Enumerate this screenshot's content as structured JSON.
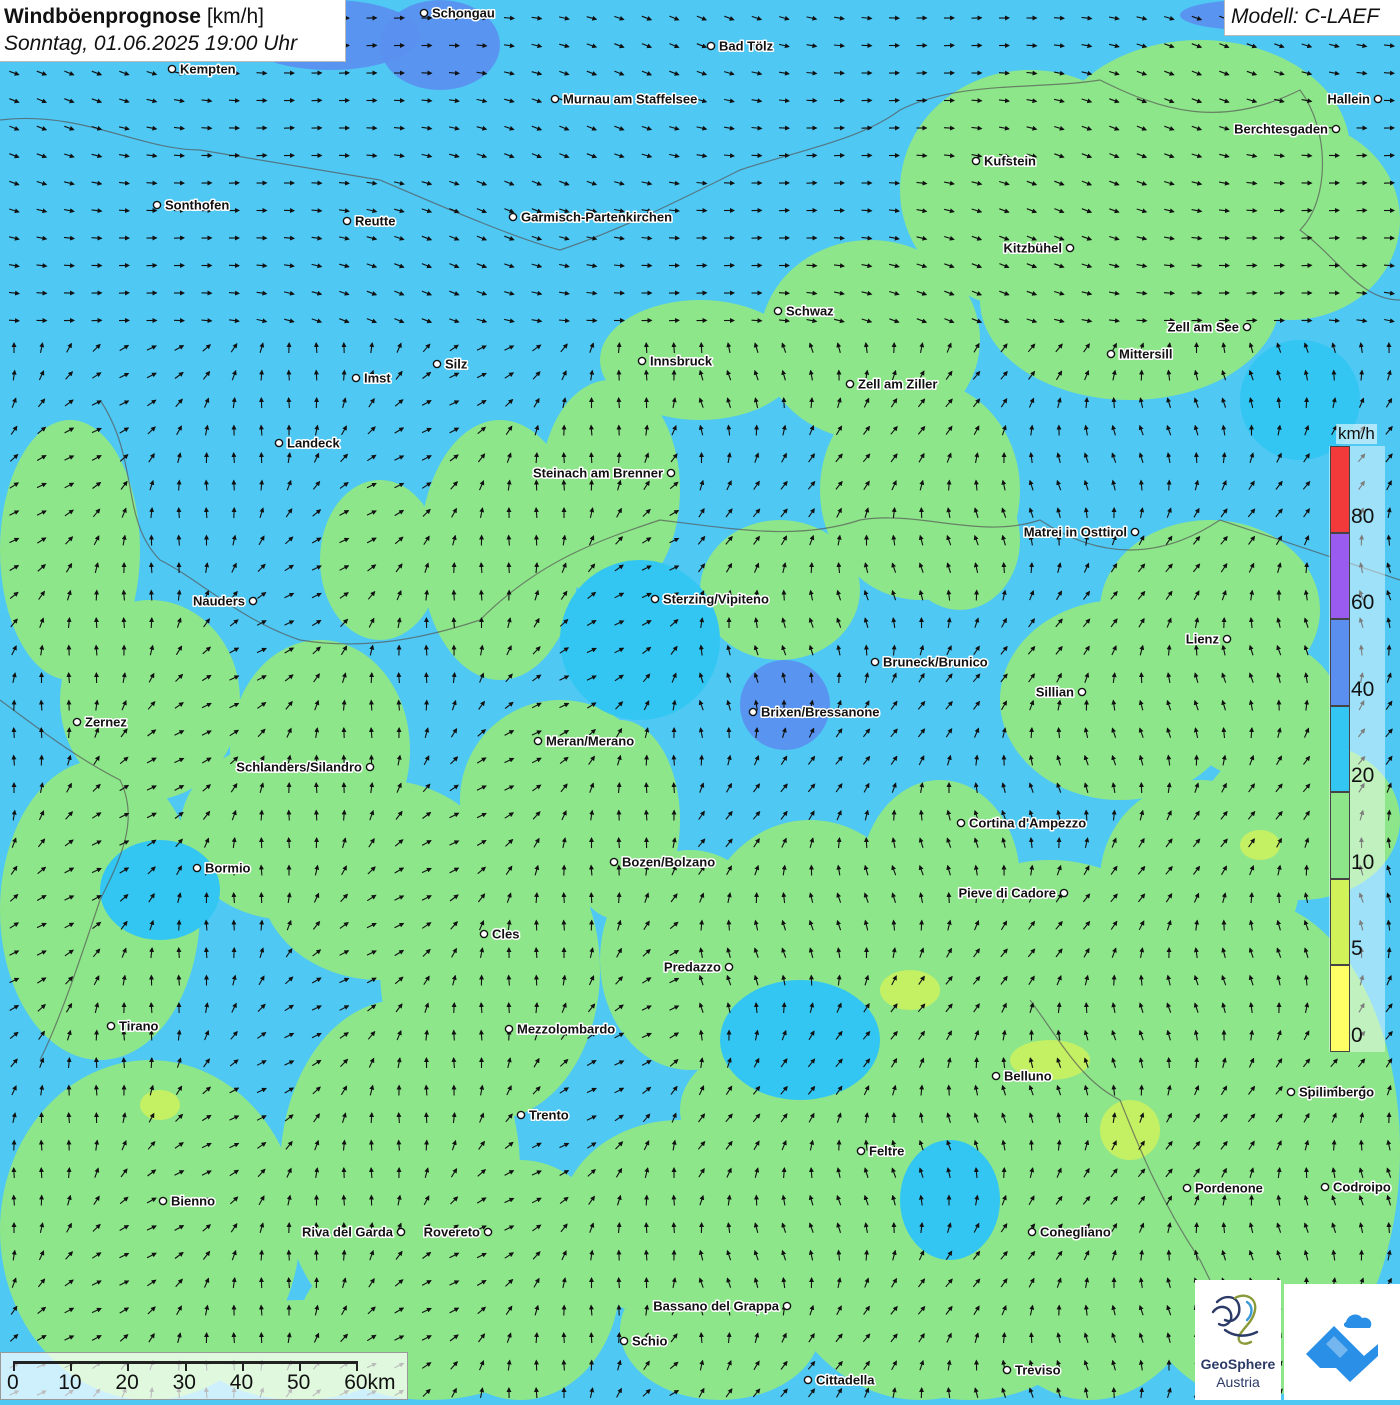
{
  "header": {
    "title": "Windböenprognose",
    "unit": "[km/h]",
    "datetime": "Sonntag, 01.06.2025 19:00 Uhr",
    "model": "Modell: C-LAEF"
  },
  "legend": {
    "unit": "km/h",
    "bins": [
      {
        "from": 0,
        "to": 5,
        "color": "#ffff66"
      },
      {
        "from": 5,
        "to": 10,
        "color": "#d2f25a"
      },
      {
        "from": 10,
        "to": 20,
        "color": "#8ee68a"
      },
      {
        "from": 20,
        "to": 40,
        "color": "#33c6f2"
      },
      {
        "from": 40,
        "to": 60,
        "color": "#5a8ff0"
      },
      {
        "from": 60,
        "to": 80,
        "color": "#9a5cf0"
      },
      {
        "from": 80,
        "to": 100,
        "color": "#f23a3a"
      }
    ],
    "labels": [
      "0",
      "5",
      "10",
      "20",
      "40",
      "60",
      "80"
    ]
  },
  "scale": {
    "labels": [
      "0",
      "10",
      "20",
      "30",
      "40",
      "50",
      "60km"
    ]
  },
  "cities": [
    {
      "name": "Schongau"
    },
    {
      "name": "Bad Tölz"
    },
    {
      "name": "Kempten"
    },
    {
      "name": "Murnau am Staffelsee"
    },
    {
      "name": "Hallein"
    },
    {
      "name": "Berchtesgaden"
    },
    {
      "name": "Kufstein"
    },
    {
      "name": "Sonthofen"
    },
    {
      "name": "Reutte"
    },
    {
      "name": "Garmisch-Partenkirchen"
    },
    {
      "name": "Kitzbühel"
    },
    {
      "name": "Schwaz"
    },
    {
      "name": "Zell am See"
    },
    {
      "name": "Innsbruck"
    },
    {
      "name": "Mittersill"
    },
    {
      "name": "Silz"
    },
    {
      "name": "Imst"
    },
    {
      "name": "Zell am Ziller"
    },
    {
      "name": "Landeck"
    },
    {
      "name": "Steinach am Brenner"
    },
    {
      "name": "Matrei in Osttirol"
    },
    {
      "name": "Nauders"
    },
    {
      "name": "Sterzing/Vipiteno"
    },
    {
      "name": "Lienz"
    },
    {
      "name": "Bruneck/Brunico"
    },
    {
      "name": "Sillian"
    },
    {
      "name": "Brixen/Bressanone"
    },
    {
      "name": "Zernez"
    },
    {
      "name": "Meran/Merano"
    },
    {
      "name": "Schlanders/Silandro"
    },
    {
      "name": "Cortina d'Ampezzo"
    },
    {
      "name": "Bozen/Bolzano"
    },
    {
      "name": "Bormio"
    },
    {
      "name": "Pieve di Cadore"
    },
    {
      "name": "Cles"
    },
    {
      "name": "Predazzo"
    },
    {
      "name": "Tirano"
    },
    {
      "name": "Mezzolombardo"
    },
    {
      "name": "Belluno"
    },
    {
      "name": "Spilimbergo"
    },
    {
      "name": "Trento"
    },
    {
      "name": "Feltre"
    },
    {
      "name": "Pordenone"
    },
    {
      "name": "Codroipo"
    },
    {
      "name": "Bienno"
    },
    {
      "name": "Riva del Garda"
    },
    {
      "name": "Rovereto"
    },
    {
      "name": "Conegliano"
    },
    {
      "name": "Bassano del Grappa"
    },
    {
      "name": "Schio"
    },
    {
      "name": "Treviso"
    },
    {
      "name": "Cittadella"
    }
  ],
  "logos": {
    "geosphere_name": "GeoSphere",
    "geosphere_sub": "Austria"
  }
}
